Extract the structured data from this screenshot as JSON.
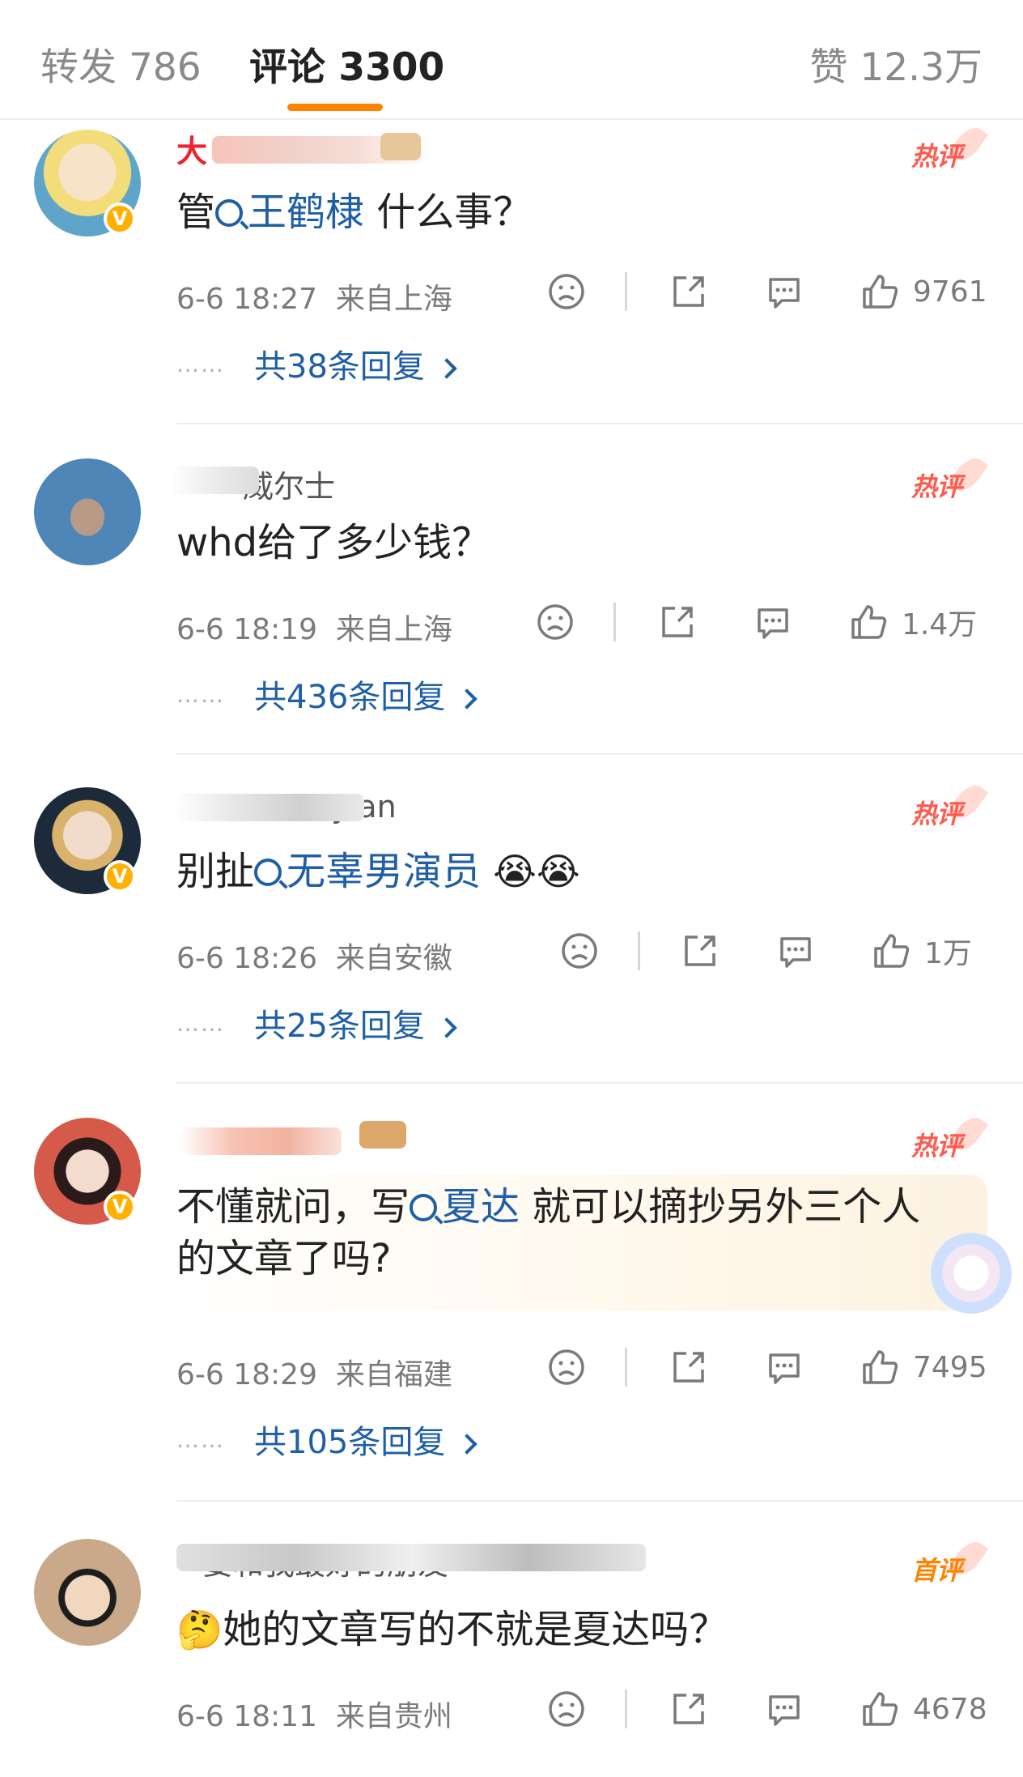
{
  "tabs": {
    "repost": "转发 786",
    "comment": "评论 3300",
    "likes": "赞 12.3万"
  },
  "colors": {
    "accent": "#ff8200",
    "link": "#1f5fa6",
    "hot": "#ff5a4e"
  },
  "comments": [
    {
      "username": "大",
      "badge": "热评",
      "content_prefix": "管",
      "topic": "王鹤棣",
      "content_suffix": " 什么事？",
      "time": "6-6 18:27",
      "location": "来自上海",
      "likes": "9761",
      "replies_text": "共38条回复",
      "dots": "……"
    },
    {
      "username": "威尔士",
      "badge": "热评",
      "content": "whd给了多少钱？",
      "time": "6-6 18:19",
      "location": "来自上海",
      "likes": "1.4万",
      "replies_text": "共436条回复",
      "dots": "……"
    },
    {
      "username": "Dylan",
      "badge": "热评",
      "content_prefix": "别扯",
      "topic": "无辜男演员",
      "emoji": "😭😭",
      "time": "6-6 18:26",
      "location": "来自安徽",
      "likes": "1万",
      "replies_text": "共25条回复",
      "dots": "……"
    },
    {
      "username": "",
      "badge": "热评",
      "content_prefix": "不懂就问，写",
      "topic": "夏达",
      "content_suffix": " 就可以摘抄另外三个人的文章了吗?",
      "time": "6-6 18:29",
      "location": "来自福建",
      "likes": "7495",
      "replies_text": "共105条回复",
      "dots": "……"
    },
    {
      "username": "要和我最好的朋友",
      "badge": "首评",
      "emoji": "🤔",
      "content": "她的文章写的不就是夏达吗？",
      "time": "6-6 18:11",
      "location": "来自贵州",
      "likes": "4678"
    }
  ],
  "icons": [
    "sad-face-icon",
    "share-icon",
    "comment-icon",
    "thumbs-up-icon",
    "search-icon",
    "chevron-right-icon",
    "verified-icon"
  ]
}
